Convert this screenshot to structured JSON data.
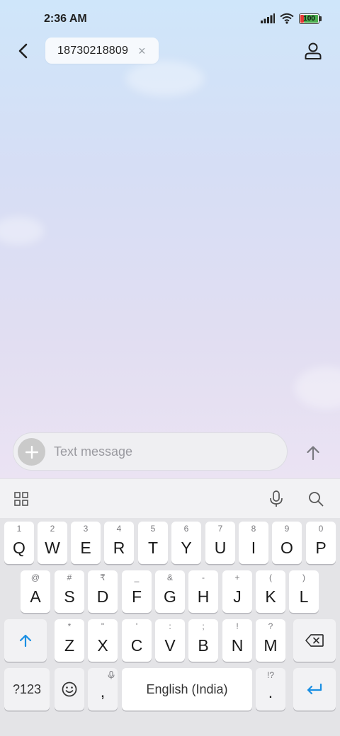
{
  "status_bar": {
    "time": "2:36 AM",
    "battery": "100"
  },
  "recipient": {
    "number": "18730218809",
    "remove_label": "×"
  },
  "composer": {
    "placeholder": "Text message"
  },
  "keyboard": {
    "row1": [
      {
        "key": "Q",
        "hint": "1"
      },
      {
        "key": "W",
        "hint": "2"
      },
      {
        "key": "E",
        "hint": "3"
      },
      {
        "key": "R",
        "hint": "4"
      },
      {
        "key": "T",
        "hint": "5"
      },
      {
        "key": "Y",
        "hint": "6"
      },
      {
        "key": "U",
        "hint": "7"
      },
      {
        "key": "I",
        "hint": "8"
      },
      {
        "key": "O",
        "hint": "9"
      },
      {
        "key": "P",
        "hint": "0"
      }
    ],
    "row2": [
      {
        "key": "A",
        "hint": "@"
      },
      {
        "key": "S",
        "hint": "#"
      },
      {
        "key": "D",
        "hint": "₹"
      },
      {
        "key": "F",
        "hint": "_"
      },
      {
        "key": "G",
        "hint": "&"
      },
      {
        "key": "H",
        "hint": "-"
      },
      {
        "key": "J",
        "hint": "+"
      },
      {
        "key": "K",
        "hint": "("
      },
      {
        "key": "L",
        "hint": ")"
      }
    ],
    "row3": [
      {
        "key": "Z",
        "hint": "*"
      },
      {
        "key": "X",
        "hint": "\""
      },
      {
        "key": "C",
        "hint": "'"
      },
      {
        "key": "V",
        "hint": ":"
      },
      {
        "key": "B",
        "hint": ";"
      },
      {
        "key": "N",
        "hint": "!"
      },
      {
        "key": "M",
        "hint": "?"
      }
    ],
    "symbols_label": "?123",
    "comma": ",",
    "space_label": "English (India)",
    "period": ".",
    "period_hint": "!?"
  },
  "colors": {
    "accent": "#1a8fe3"
  }
}
